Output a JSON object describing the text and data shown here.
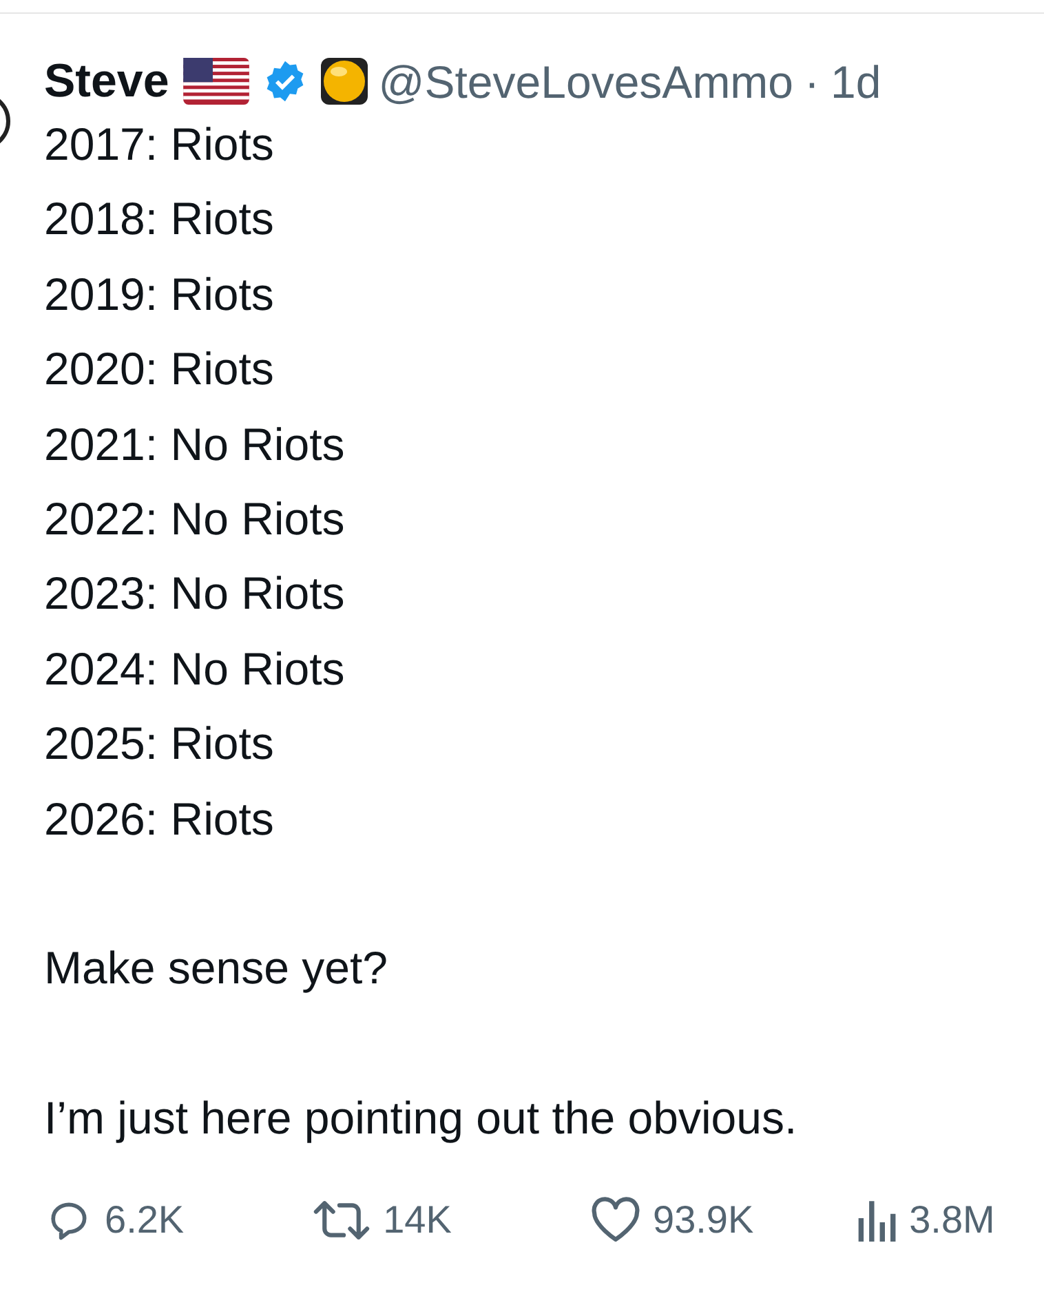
{
  "author": {
    "name": "Steve",
    "handle": "@SteveLovesAmmo",
    "separator": "·",
    "time": "1d",
    "verified": true
  },
  "lines": [
    "2017: Riots",
    "2018: Riots",
    "2019: Riots",
    "2020: Riots",
    "2021: No Riots",
    "2022: No Riots",
    "2023: No Riots",
    "2024: No Riots",
    "2025: Riots",
    "2026: Riots"
  ],
  "paragraphs": [
    "Make sense yet?",
    "I’m just here pointing out the obvious."
  ],
  "stats": [
    {
      "kind": "reply",
      "count": "6.2K"
    },
    {
      "kind": "repost",
      "count": "14K"
    },
    {
      "kind": "like",
      "count": "93.9K"
    },
    {
      "kind": "views",
      "count": "3.8M"
    }
  ]
}
